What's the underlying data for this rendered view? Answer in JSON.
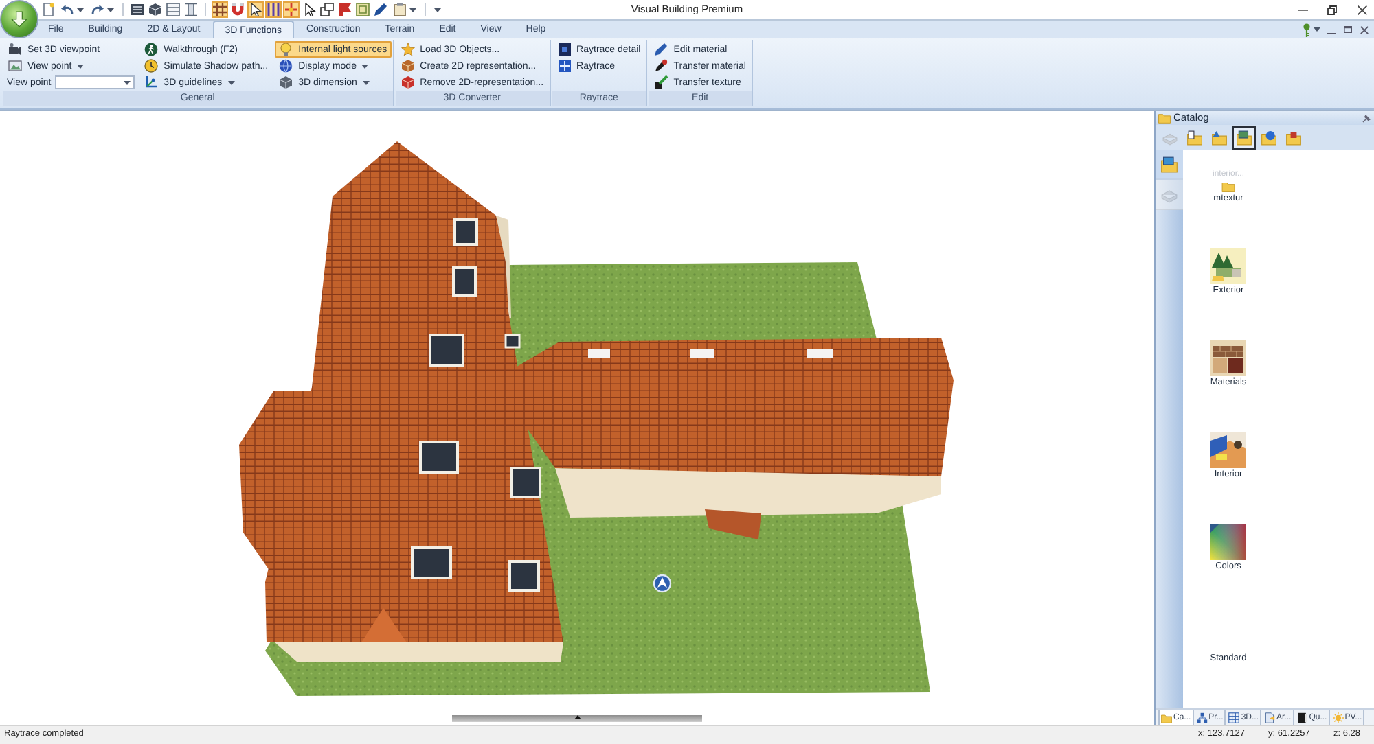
{
  "window": {
    "title": "Visual Building Premium"
  },
  "quick_access_toolbar": [
    [
      {
        "kind": "button",
        "on": false
      },
      {
        "kind": "split",
        "on": false
      },
      {
        "kind": "split",
        "on": false
      }
    ],
    [
      {
        "kind": "button",
        "on": false
      },
      {
        "kind": "button",
        "on": false
      },
      {
        "kind": "button",
        "on": false
      },
      {
        "kind": "button",
        "on": false
      }
    ],
    [
      {
        "kind": "button",
        "on": true
      },
      {
        "kind": "button",
        "on": false
      },
      {
        "kind": "button",
        "on": true
      },
      {
        "kind": "button",
        "on": true
      },
      {
        "kind": "button",
        "on": true
      },
      {
        "kind": "button",
        "on": false
      },
      {
        "kind": "button",
        "on": false
      },
      {
        "kind": "button",
        "on": false
      },
      {
        "kind": "button",
        "on": false
      },
      {
        "kind": "button",
        "on": false
      },
      {
        "kind": "split",
        "on": false
      }
    ],
    [
      {
        "kind": "menu",
        "on": false
      }
    ]
  ],
  "ribbon": {
    "tabs": [
      {
        "label": "File",
        "selected": false
      },
      {
        "label": "Building",
        "selected": false
      },
      {
        "label": "2D & Layout",
        "selected": false
      },
      {
        "label": "3D Functions",
        "selected": true
      },
      {
        "label": "Construction",
        "selected": false
      },
      {
        "label": "Terrain",
        "selected": false
      },
      {
        "label": "Edit",
        "selected": false
      },
      {
        "label": "View",
        "selected": false
      },
      {
        "label": "Help",
        "selected": false
      }
    ],
    "groups": [
      {
        "label": "General",
        "columns": [
          [
            {
              "kind": "button",
              "label": "Set 3D viewpoint",
              "on": false
            },
            {
              "kind": "dropdown",
              "label": "View point",
              "on": false
            },
            {
              "kind": "combo",
              "label": "View point"
            }
          ],
          [
            {
              "kind": "button",
              "label": "Walkthrough (F2)",
              "on": false
            },
            {
              "kind": "button",
              "label": "Simulate Shadow path...",
              "on": false
            },
            {
              "kind": "dropdown",
              "label": "3D guidelines",
              "on": false
            }
          ],
          [
            {
              "kind": "button",
              "label": "Internal light sources",
              "on": true
            },
            {
              "kind": "dropdown",
              "label": "Display mode",
              "on": false
            },
            {
              "kind": "dropdown",
              "label": "3D dimension",
              "on": false
            }
          ]
        ]
      },
      {
        "label": "3D Converter",
        "columns": [
          [
            {
              "kind": "button",
              "label": "Load 3D Objects...",
              "on": false
            },
            {
              "kind": "button",
              "label": "Create 2D representation...",
              "on": false
            },
            {
              "kind": "button",
              "label": "Remove 2D-representation...",
              "on": false
            }
          ]
        ]
      },
      {
        "label": "Raytrace",
        "columns": [
          [
            {
              "kind": "button",
              "label": "Raytrace detail",
              "on": false
            },
            {
              "kind": "button",
              "label": "Raytrace",
              "on": false
            }
          ]
        ]
      },
      {
        "label": "Edit",
        "columns": [
          [
            {
              "kind": "button",
              "label": "Edit material",
              "on": false
            },
            {
              "kind": "button",
              "label": "Transfer material",
              "on": false
            },
            {
              "kind": "button",
              "label": "Transfer texture",
              "on": false
            }
          ]
        ]
      }
    ]
  },
  "catalog": {
    "title": "Catalog",
    "toolbar": [
      {
        "selected": false,
        "disabled": true
      },
      {
        "selected": false,
        "disabled": false
      },
      {
        "selected": false,
        "disabled": false
      },
      {
        "selected": true,
        "disabled": false
      },
      {
        "selected": false,
        "disabled": false
      },
      {
        "selected": false,
        "disabled": false
      }
    ],
    "side_tabs": [
      {
        "selected": true,
        "disabled": false
      },
      {
        "selected": false,
        "disabled": true
      }
    ],
    "faded_label": "interior...",
    "items": [
      {
        "kind": "folder",
        "label": "mtextur"
      },
      {
        "kind": "trees",
        "label": "Exterior"
      },
      {
        "kind": "bricks",
        "label": "Materials"
      },
      {
        "kind": "room",
        "label": "Interior"
      },
      {
        "kind": "gradient",
        "label": "Colors"
      },
      {
        "kind": "none",
        "label": "Standard"
      }
    ],
    "bottom_tabs": [
      {
        "label": "Ca...",
        "selected": true
      },
      {
        "label": "Pr...",
        "selected": false
      },
      {
        "label": "3D...",
        "selected": false
      },
      {
        "label": "Ar...",
        "selected": false
      },
      {
        "label": "Qu...",
        "selected": false
      },
      {
        "label": "PV...",
        "selected": false
      }
    ]
  },
  "status_bar": {
    "message": "Raytrace completed",
    "coordinates": [
      "x: 123.7127",
      "y: 61.2257",
      "z: 6.28"
    ]
  }
}
